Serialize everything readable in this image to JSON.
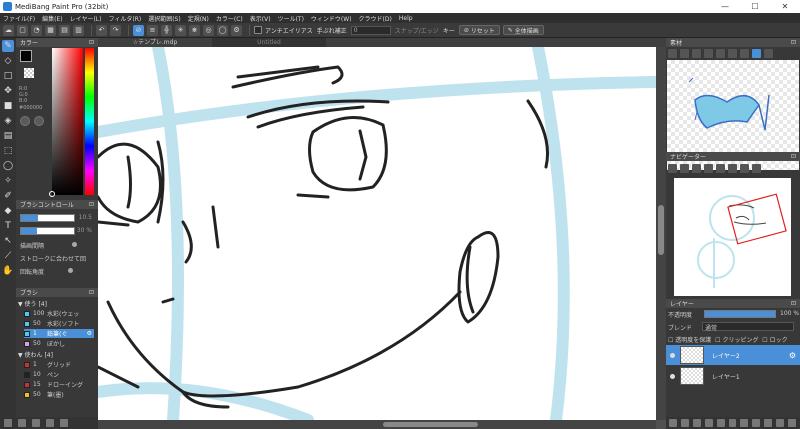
{
  "window": {
    "title": "MediBang Paint Pro (32bit)",
    "minimize": "—",
    "maximize": "☐",
    "close": "✕"
  },
  "menu": [
    "ファイル(F)",
    "編集(E)",
    "レイヤー(L)",
    "フィルタ(R)",
    "選択範囲(S)",
    "定規(N)",
    "カラー(C)",
    "表示(V)",
    "ツール(T)",
    "ウィンドウ(W)",
    "クラウド(D)",
    "Help"
  ],
  "toolbar": {
    "antialias_label": "アンチエイリアス",
    "stabilizer_label": "手ぶれ補正",
    "stabilizer_value": "0",
    "snap_label": "スナップ/エッジ",
    "key_label": "キー",
    "reset_label": "リセット",
    "select_all_label": "全体描画"
  },
  "tools": [
    {
      "name": "brush",
      "glyph": "✎",
      "active": true
    },
    {
      "name": "eraser",
      "glyph": "◇"
    },
    {
      "name": "shape",
      "glyph": "□"
    },
    {
      "name": "move",
      "glyph": "✥"
    },
    {
      "name": "fill-rect",
      "glyph": "■"
    },
    {
      "name": "bucket",
      "glyph": "◈"
    },
    {
      "name": "gradient",
      "glyph": "▤"
    },
    {
      "name": "select",
      "glyph": "⬚"
    },
    {
      "name": "lasso",
      "glyph": "◯"
    },
    {
      "name": "magic-wand",
      "glyph": "✧"
    },
    {
      "name": "select-pen",
      "glyph": "✐"
    },
    {
      "name": "select-eraser",
      "glyph": "◆"
    },
    {
      "name": "text",
      "glyph": "T"
    },
    {
      "name": "operation",
      "glyph": "↖"
    },
    {
      "name": "eyedropper",
      "glyph": "⟋"
    },
    {
      "name": "hand",
      "glyph": "✋"
    }
  ],
  "color_panel": {
    "title": "カラー",
    "r": "R:0",
    "g": "G:0",
    "b": "B:0",
    "hex": "#000000"
  },
  "brush_control": {
    "title": "ブラシコントロール",
    "size_value": "10.5",
    "opacity_value": "30 %",
    "interval_label": "描画間隔",
    "follow_label": "ストロークに合わせて回",
    "rotate_label": "回転角度"
  },
  "brush_panel": {
    "title": "ブラシ",
    "groups": [
      {
        "label": "使う [4]",
        "items": [
          {
            "num": "100",
            "name": "水彩(ウェッ",
            "color": "#4ec9f0"
          },
          {
            "num": "50",
            "name": "水彩(ソフト",
            "color": "#4ec9f0"
          },
          {
            "num": "1",
            "name": "鉛筆(ぐ",
            "color": "#4ec9f0",
            "selected": true
          },
          {
            "num": "50",
            "name": "ぼかし",
            "color": "#d8a0e8"
          }
        ]
      },
      {
        "label": "使わん [4]",
        "items": [
          {
            "num": "1",
            "name": "グリッド",
            "color": "#c83232"
          },
          {
            "num": "10",
            "name": "ペン",
            "color": "#222222"
          },
          {
            "num": "15",
            "name": "ドローイング",
            "color": "#c83232"
          },
          {
            "num": "50",
            "name": "筆(墨)",
            "color": "#e8c020"
          }
        ]
      }
    ]
  },
  "canvas": {
    "tabs": [
      "☆テンプレ.mdp",
      "Untitled"
    ]
  },
  "material_panel": {
    "title": "素材"
  },
  "navigator_panel": {
    "title": "ナビゲーター"
  },
  "layer_panel": {
    "title": "レイヤー",
    "opacity_label": "不透明度",
    "opacity_value": "100 %",
    "opacity_fraction": 1.0,
    "blend_label": "ブレンド",
    "blend_value": "通常",
    "protect_label": "透明度を保護",
    "clipping_label": "クリッピング",
    "lock_label": "ロック",
    "layers": [
      {
        "name": "レイヤー2",
        "selected": true
      },
      {
        "name": "レイヤー1",
        "selected": false
      }
    ]
  }
}
